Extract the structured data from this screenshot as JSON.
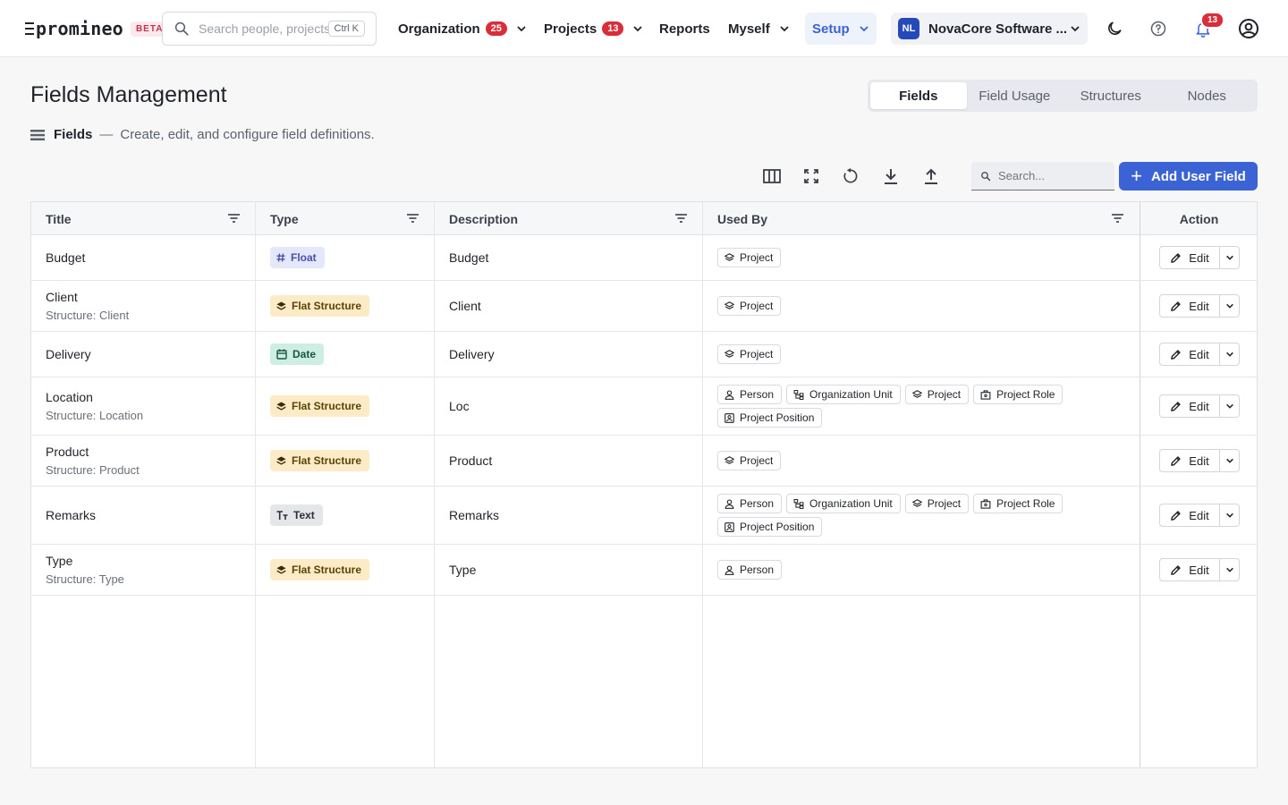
{
  "nav": {
    "logo_text": "promineo",
    "beta_label": "BETA",
    "search_placeholder": "Search people, projects...",
    "search_shortcut": "Ctrl K",
    "menus": [
      {
        "label": "Organization",
        "badge": "25"
      },
      {
        "label": "Projects",
        "badge": "13"
      },
      {
        "label": "Reports"
      },
      {
        "label": "Myself"
      },
      {
        "label": "Setup"
      }
    ],
    "org_initials": "NL",
    "org_name": "NovaCore Software ...",
    "notifications_count": "13"
  },
  "page": {
    "title": "Fields Management",
    "tabs": [
      "Fields",
      "Field Usage",
      "Structures",
      "Nodes"
    ],
    "active_tab": "Fields",
    "section_label": "Fields",
    "section_separator": "—",
    "section_description": "Create, edit, and configure field definitions."
  },
  "toolbar": {
    "search_placeholder": "Search...",
    "add_button": "Add User Field"
  },
  "table": {
    "columns": [
      "Title",
      "Type",
      "Description",
      "Used By",
      "Action"
    ],
    "edit_label": "Edit",
    "rows": [
      {
        "title": "Budget",
        "subtitle": "",
        "type": "Float",
        "description": "Budget",
        "used_by": [
          "Project"
        ]
      },
      {
        "title": "Client",
        "subtitle": "Structure: Client",
        "type": "Flat Structure",
        "description": "Client",
        "used_by": [
          "Project"
        ]
      },
      {
        "title": "Delivery",
        "subtitle": "",
        "type": "Date",
        "description": "Delivery",
        "used_by": [
          "Project"
        ]
      },
      {
        "title": "Location",
        "subtitle": "Structure: Location",
        "type": "Flat Structure",
        "description": "Loc",
        "used_by": [
          "Person",
          "Organization Unit",
          "Project",
          "Project Role",
          "Project Position"
        ]
      },
      {
        "title": "Product",
        "subtitle": "Structure: Product",
        "type": "Flat Structure",
        "description": "Product",
        "used_by": [
          "Project"
        ]
      },
      {
        "title": "Remarks",
        "subtitle": "",
        "type": "Text",
        "description": "Remarks",
        "used_by": [
          "Person",
          "Organization Unit",
          "Project",
          "Project Role",
          "Project Position"
        ]
      },
      {
        "title": "Type",
        "subtitle": "Structure: Type",
        "type": "Flat Structure",
        "description": "Type",
        "used_by": [
          "Person"
        ]
      }
    ]
  },
  "colors": {
    "accent": "#3b63d6",
    "badge_red": "#d92d3a",
    "float_bg": "#e5e7fb",
    "flat_bg": "#fbecc7",
    "date_bg": "#cfeee3",
    "text_bg": "#e4e6ea"
  }
}
